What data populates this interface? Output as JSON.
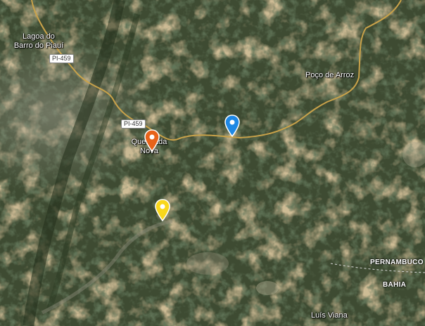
{
  "places": {
    "lagoa_line1": "Lagoa do",
    "lagoa_line2": "Barro do Piauí",
    "poco": "Poço de Arroz",
    "queimada_line1": "Queimada",
    "queimada_line2": "Nova",
    "luis": "Luís Viana"
  },
  "states": {
    "pernambuco": "PERNAMBUCO",
    "bahia": "BAHIA"
  },
  "roads": {
    "shield_top": "PI-459",
    "shield_mid": "PI-459"
  },
  "markers": [
    {
      "id": "orange",
      "color": "#e8631a",
      "icon": "map-pin-icon"
    },
    {
      "id": "blue",
      "color": "#1e88e5",
      "icon": "map-pin-icon"
    },
    {
      "id": "yellow",
      "color": "#f9d71c",
      "icon": "map-pin-icon"
    }
  ],
  "colors": {
    "road": "#c9a24a",
    "border": "#d8d8d8"
  }
}
